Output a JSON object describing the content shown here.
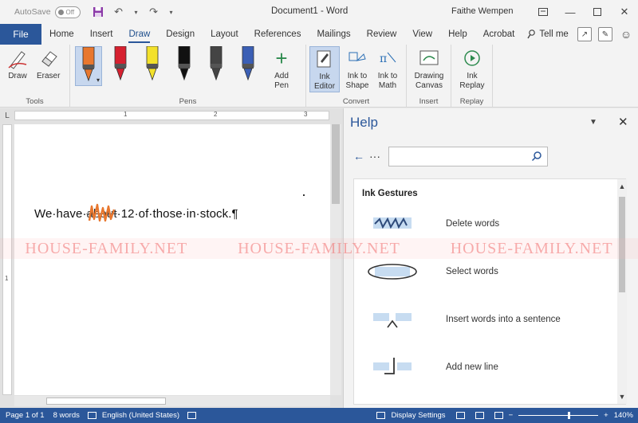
{
  "titlebar": {
    "autosave_label": "AutoSave",
    "autosave_state": "Off",
    "document_title": "Document1 - Word",
    "user_name": "Faithe Wempen"
  },
  "tabs": {
    "file": "File",
    "items": [
      "Home",
      "Insert",
      "Draw",
      "Design",
      "Layout",
      "References",
      "Mailings",
      "Review",
      "View",
      "Help",
      "Acrobat"
    ],
    "active": "Draw",
    "tell_me": "Tell me"
  },
  "ribbon": {
    "tools": {
      "draw": "Draw",
      "eraser": "Eraser",
      "group_label": "Tools"
    },
    "pens": {
      "group_label": "Pens",
      "colors": [
        "#e8772e",
        "#d6202f",
        "#f3e12a",
        "#111111",
        "#444444",
        "#3b5fb5"
      ],
      "add_pen": "Add Pen"
    },
    "convert": {
      "ink_editor": "Ink Editor",
      "ink_to_shape": "Ink to Shape",
      "ink_to_math": "Ink to Math",
      "group_label": "Convert"
    },
    "insert": {
      "drawing_canvas": "Drawing Canvas",
      "group_label": "Insert"
    },
    "replay": {
      "ink_replay": "Ink Replay",
      "group_label": "Replay"
    }
  },
  "document": {
    "ruler_marks": [
      "1",
      "2",
      "3"
    ],
    "vruler_marks": [
      "1"
    ],
    "text_before": "We·have·",
    "text_struck": "about",
    "text_after": "·12·of·those·in·stock.¶"
  },
  "help": {
    "title": "Help",
    "search_placeholder": "",
    "section_title": "Ink Gestures",
    "gestures": [
      {
        "label": "Delete words"
      },
      {
        "label": "Select words"
      },
      {
        "label": "Insert words into a sentence"
      },
      {
        "label": "Add new line"
      }
    ]
  },
  "watermark": [
    "HOUSE-FAMILY.NET",
    "HOUSE-FAMILY.NET",
    "HOUSE-FAMILY.NET"
  ],
  "statusbar": {
    "page": "Page 1 of 1",
    "words": "8 words",
    "language": "English (United States)",
    "display_settings": "Display Settings",
    "zoom": "140%"
  }
}
